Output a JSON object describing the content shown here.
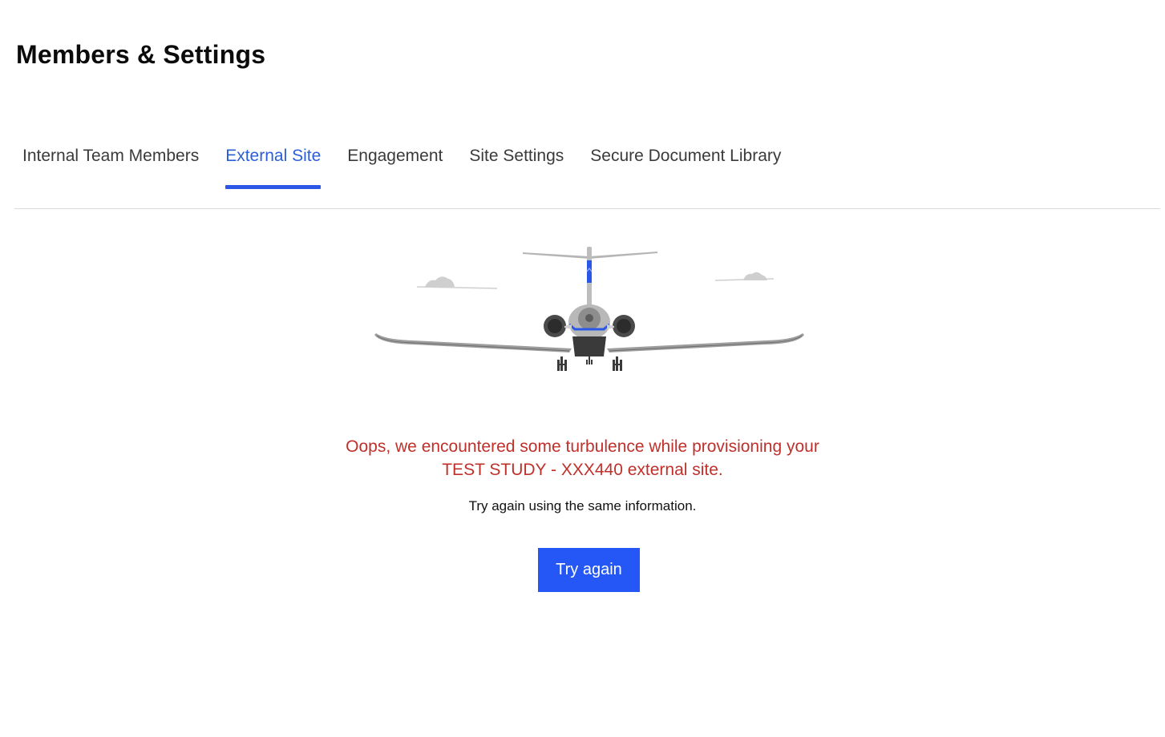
{
  "page": {
    "title": "Members & Settings"
  },
  "tabs": [
    {
      "label": "Internal Team Members",
      "active": false
    },
    {
      "label": "External Site",
      "active": true
    },
    {
      "label": "Engagement",
      "active": false
    },
    {
      "label": "Site Settings",
      "active": false
    },
    {
      "label": "Secure Document Library",
      "active": false
    }
  ],
  "error": {
    "line1": "Oops, we encountered some turbulence while provisioning your",
    "line2": "TEST STUDY - XXX440 external site.",
    "hint": "Try again using the same information.",
    "retry_label": "Try again"
  },
  "illustration": {
    "icon": "airplane-illustration",
    "colors": {
      "accent": "#2b57e6",
      "error": "#c0302b",
      "tab_active": "#2b5fd9"
    }
  }
}
